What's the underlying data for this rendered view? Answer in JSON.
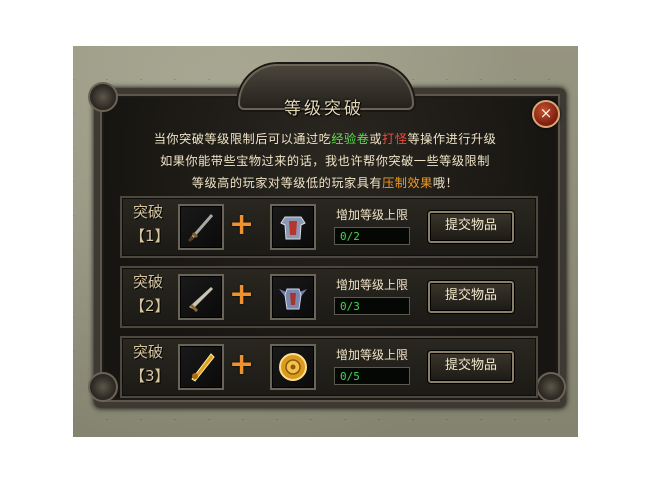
{
  "dialog": {
    "title": "等级突破",
    "close_label": "×",
    "intro": {
      "line1_pre": "当你突破等级限制后可以通过吃",
      "line1_hl1": "经验卷",
      "line1_mid": "或",
      "line1_hl2": "打怪",
      "line1_post": "等操作进行升级",
      "line2": "如果你能带些宝物过来的话，我也许帮你突破一些等级限制",
      "line3_pre": "等级高的玩家对等级低的玩家具有",
      "line3_hl": "压制效果",
      "line3_post": "哦！"
    },
    "colors": {
      "highlight_green": "#59e04f",
      "highlight_red": "#f04a3a",
      "highlight_orange": "#f29a24",
      "counter_text": "#41d84a"
    }
  },
  "rows": [
    {
      "label_top": "突破",
      "label_bottom": "【1】",
      "weapon_icon": "sword-icon",
      "armor_icon": "armor-icon",
      "plus": "+",
      "limit_label": "增加等级上限",
      "counter": "0/2",
      "submit_label": "提交物品"
    },
    {
      "label_top": "突破",
      "label_bottom": "【2】",
      "weapon_icon": "blade-icon",
      "armor_icon": "winged-armor-icon",
      "plus": "+",
      "limit_label": "增加等级上限",
      "counter": "0/3",
      "submit_label": "提交物品"
    },
    {
      "label_top": "突破",
      "label_bottom": "【3】",
      "weapon_icon": "golden-sword-icon",
      "armor_icon": "golden-armor-icon",
      "plus": "+",
      "limit_label": "增加等级上限",
      "counter": "0/5",
      "submit_label": "提交物品"
    }
  ]
}
